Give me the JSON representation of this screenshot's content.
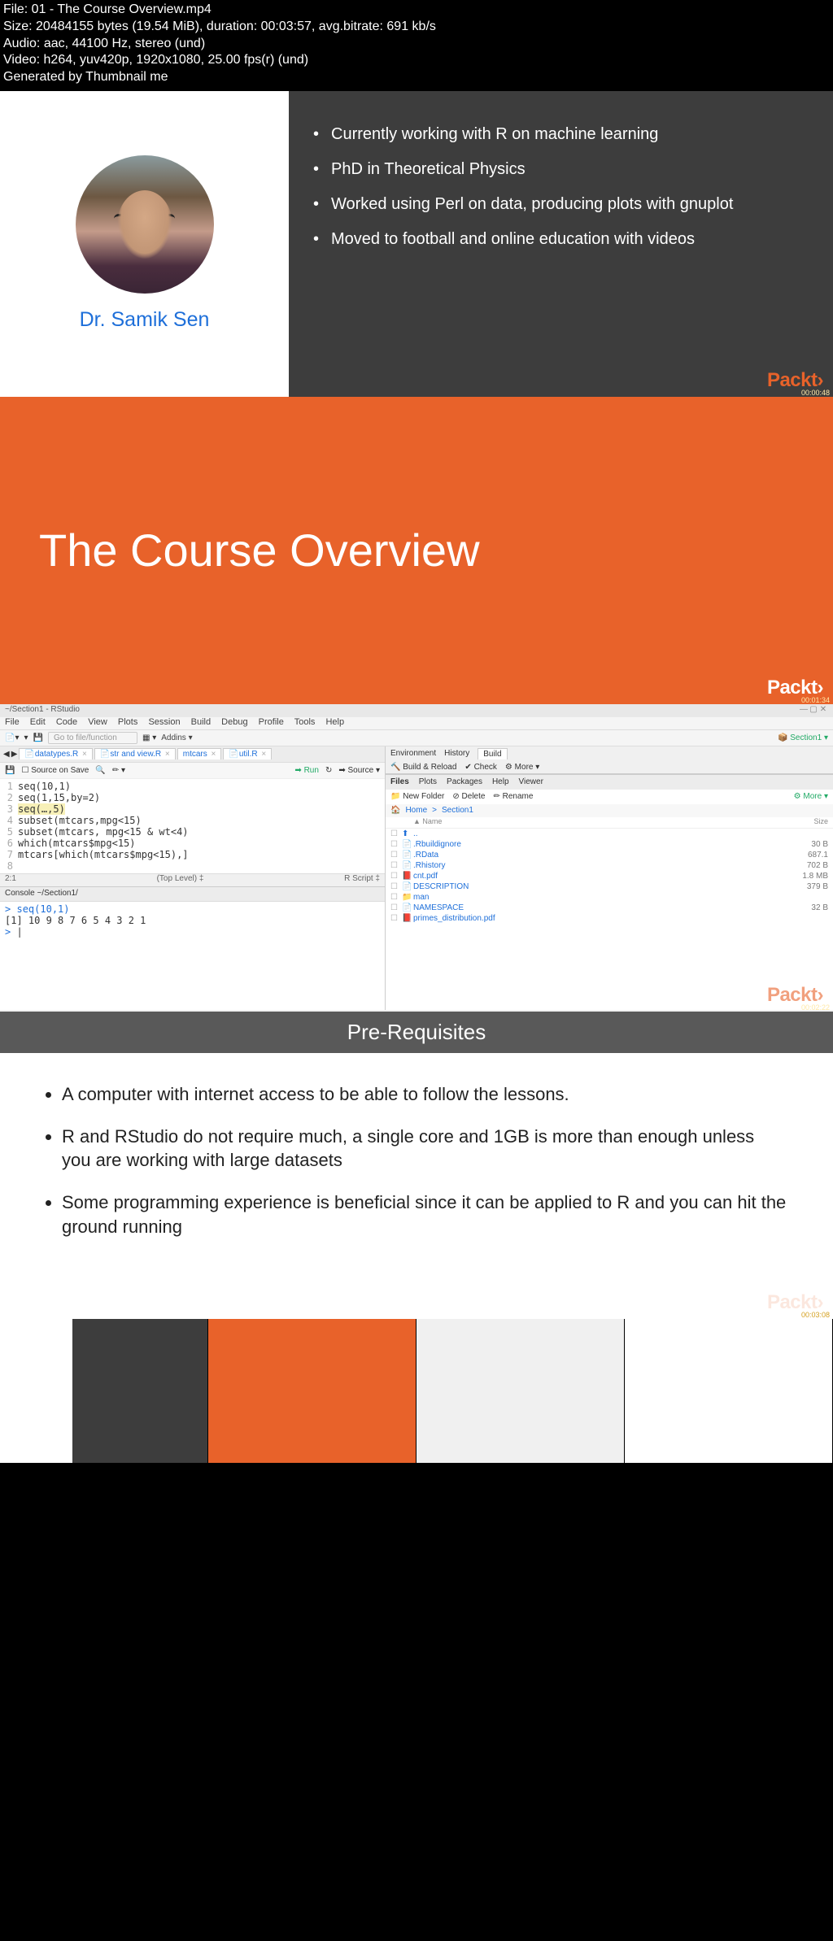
{
  "meta": {
    "l1": "File: 01 - The Course Overview.mp4",
    "l2": "Size: 20484155 bytes (19.54 MiB), duration: 00:03:57, avg.bitrate: 691 kb/s",
    "l3": "Audio: aac, 44100 Hz, stereo (und)",
    "l4": "Video: h264, yuv420p, 1920x1080, 25.00 fps(r) (und)",
    "l5": "Generated by Thumbnail me"
  },
  "slide1": {
    "author": "Dr. Samik Sen",
    "bullets": [
      "Currently working with R on machine learning",
      "PhD in Theoretical Physics",
      "Worked using Perl on data, producing plots with gnuplot",
      "Moved to football and online education with videos"
    ],
    "brand": "Packt",
    "ts": "00:00:48"
  },
  "slide2": {
    "title": "The Course Overview",
    "brand": "Packt",
    "ts": "00:01:34"
  },
  "slide3": {
    "title": "~/Section1 - RStudio",
    "menus": [
      "File",
      "Edit",
      "Code",
      "View",
      "Plots",
      "Session",
      "Build",
      "Debug",
      "Profile",
      "Tools",
      "Help"
    ],
    "goto": "Go to file/function",
    "addins": "Addins",
    "project": "Section1",
    "tabs": [
      "datatypes.R",
      "str and view.R",
      "mtcars",
      "util.R"
    ],
    "sourceOnSave": "Source on Save",
    "run": "Run",
    "source": "Source",
    "code": [
      {
        "n": "1",
        "t": "seq(10,1)"
      },
      {
        "n": "2",
        "t": "seq(1,15,by=2)"
      },
      {
        "n": "3",
        "t": "seq(…,5)",
        "hl": true
      },
      {
        "n": "4",
        "t": "subset(mtcars,mpg<15)"
      },
      {
        "n": "5",
        "t": "subset(mtcars, mpg<15 & wt<4)"
      },
      {
        "n": "6",
        "t": "which(mtcars$mpg<15)"
      },
      {
        "n": "7",
        "t": "mtcars[which(mtcars$mpg<15),]"
      },
      {
        "n": "8",
        "t": ""
      }
    ],
    "efoot_left": "2:1",
    "efoot_mid": "(Top Level) ‡",
    "efoot_right": "R Script ‡",
    "console_head": "Console ~/Section1/",
    "console_l1_prompt": ">",
    "console_l1": "seq(10,1)",
    "console_l2": "[1] 10  9  8  7  6  5  4  3  2  1",
    "console_l3": ">",
    "env_tabs": [
      "Environment",
      "History",
      "Build"
    ],
    "env_tool": [
      "Build & Reload",
      "Check",
      "More"
    ],
    "file_tabs": [
      "Files",
      "Plots",
      "Packages",
      "Help",
      "Viewer"
    ],
    "file_tool": {
      "new": "New Folder",
      "del": "Delete",
      "ren": "Rename",
      "more": "More"
    },
    "path": [
      "Home",
      "Section1"
    ],
    "name_h": "Name",
    "size_h": "Size",
    "files": [
      {
        "ic": "⬆",
        "nm": "..",
        "sz": ""
      },
      {
        "ic": "📄",
        "nm": ".Rbuildignore",
        "sz": "30 B"
      },
      {
        "ic": "📄",
        "nm": ".RData",
        "sz": "687.1"
      },
      {
        "ic": "📄",
        "nm": ".Rhistory",
        "sz": "702 B"
      },
      {
        "ic": "📕",
        "nm": "cnt.pdf",
        "sz": "1.8 MB"
      },
      {
        "ic": "📄",
        "nm": "DESCRIPTION",
        "sz": "379 B"
      },
      {
        "ic": "📁",
        "nm": "man",
        "sz": ""
      },
      {
        "ic": "📄",
        "nm": "NAMESPACE",
        "sz": "32 B"
      },
      {
        "ic": "📕",
        "nm": "primes_distribution.pdf",
        "sz": ""
      }
    ],
    "brand": "Packt",
    "ts": "00:02:22"
  },
  "slide4": {
    "heading": "Pre-Requisites",
    "bullets": [
      "A computer with internet access to be able to follow the lessons.",
      "R and RStudio do not require much, a single core and 1GB is more than enough unless you are working with large datasets",
      "Some programming experience is beneficial since it can be applied to R and you can hit the ground running"
    ],
    "brand": "Packt",
    "ts": "00:03:08"
  }
}
